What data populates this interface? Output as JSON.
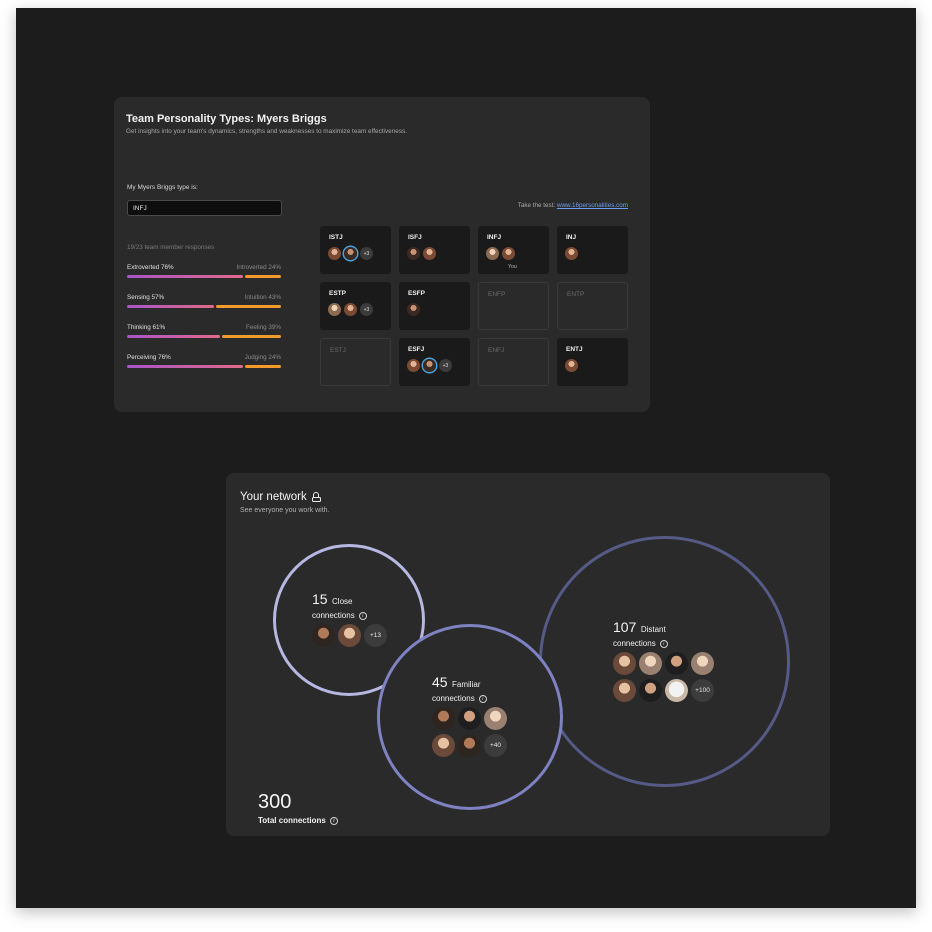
{
  "myers_briggs": {
    "title": "Team Personality Types: Myers Briggs",
    "subtitle": "Get insights into your team's dynamics, strengths and weaknesses to maximize team effectiveness.",
    "type_label": "My Myers Briggs type is:",
    "type_value": "INFJ",
    "test_prefix": "Take the test: ",
    "test_link": "www.16personalities.com",
    "responses": "19/23 team member responses",
    "traits": [
      {
        "left": "Extroverted 76%",
        "right": "Introverted 24%",
        "left_pct": 76
      },
      {
        "left": "Sensing 57%",
        "right": "Intuition 43%",
        "left_pct": 57
      },
      {
        "left": "Thinking 61%",
        "right": "Feeling 39%",
        "left_pct": 61
      },
      {
        "left": "Perceiving 76%",
        "right": "Judging 24%",
        "left_pct": 76
      }
    ],
    "types": [
      {
        "label": "ISTJ",
        "more": "+3"
      },
      {
        "label": "ISFJ"
      },
      {
        "label": "INFJ",
        "you": "You"
      },
      {
        "label": "INJ"
      },
      {
        "label": "ESTP",
        "more": "+3"
      },
      {
        "label": "ESFP"
      },
      {
        "label": "ENFP"
      },
      {
        "label": "ENTP"
      },
      {
        "label": "ESTJ"
      },
      {
        "label": "ESFJ",
        "more": "+3"
      },
      {
        "label": "ENFJ"
      },
      {
        "label": "ENTJ"
      }
    ],
    "colors": {
      "bar_left": "#a855c8",
      "bar_right": "#f39a2a",
      "link": "#6e9cf0"
    }
  },
  "network": {
    "title": "Your network",
    "subtitle": "See everyone you work with.",
    "close": {
      "count": "15",
      "word": "Close",
      "sub": "connections",
      "more": "+13"
    },
    "familiar": {
      "count": "45",
      "word": "Familiar",
      "sub": "connections",
      "more": "+40"
    },
    "distant": {
      "count": "107",
      "word": "Distant",
      "sub": "connections",
      "more": "+100"
    },
    "total": {
      "count": "300",
      "label": "Total connections"
    },
    "icons": {
      "title": "lock-icon",
      "info": "info-icon"
    },
    "colors": {
      "close_ring": "#b6b8e2",
      "familiar_ring": "#7e82c2",
      "distant_ring": "#565a86"
    }
  }
}
